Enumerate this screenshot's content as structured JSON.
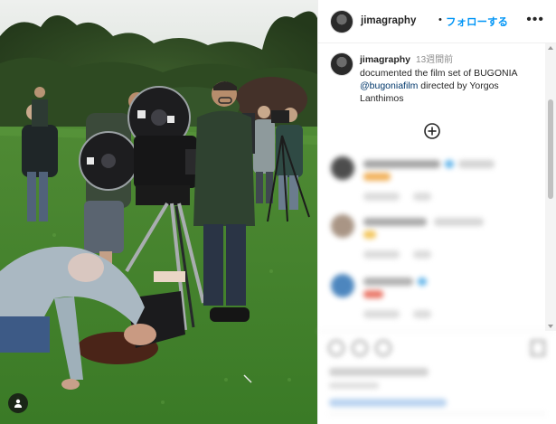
{
  "post": {
    "username": "jimagraphy",
    "separator": "•",
    "follow_label": "フォローする",
    "more_label": "•••"
  },
  "caption": {
    "username": "jimagraphy",
    "time": "13週間前",
    "line1": "documented the film set of BUGONIA",
    "mention": "@bugoniafilm",
    "line2_rest": " directed by Yorgos",
    "line3": "Lanthimos"
  },
  "icons": {
    "avatar": "avatar-icon",
    "load_more": "plus-circle-icon",
    "user_tag": "user-tag-icon",
    "more": "more-options-icon"
  },
  "colors": {
    "accent": "#0095f6",
    "link": "#00376b",
    "text": "#262626",
    "muted": "#8e8e8e",
    "divider": "#efefef"
  }
}
